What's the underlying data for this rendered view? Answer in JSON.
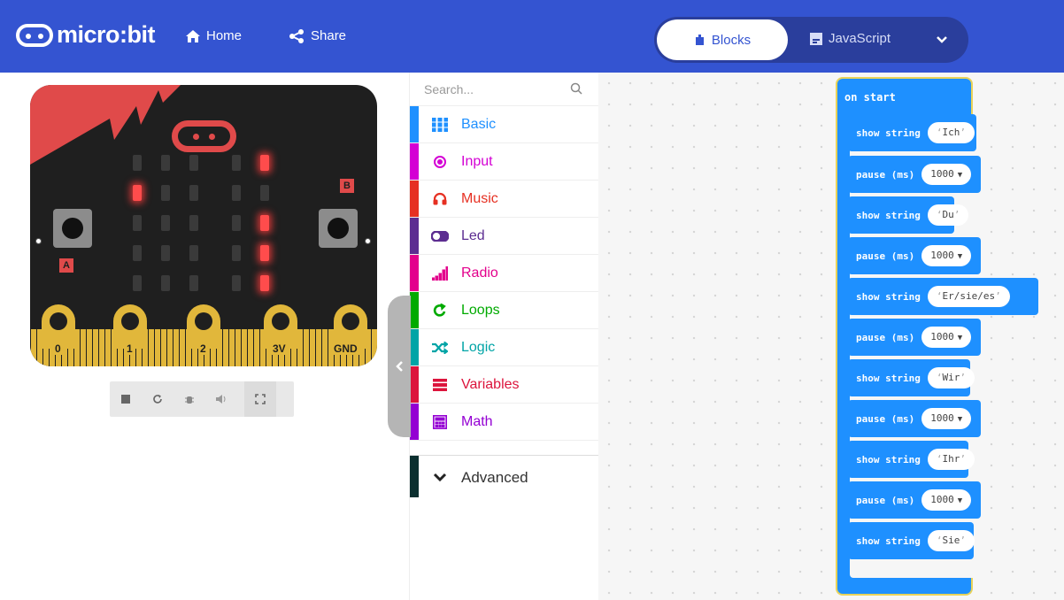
{
  "header": {
    "logo_text": "micro:bit",
    "home_label": "Home",
    "share_label": "Share",
    "blocks_label": "Blocks",
    "javascript_label": "JavaScript",
    "colors": {
      "bar": "#3454d1",
      "toggle_bg": "#2a3e9c"
    }
  },
  "simulator": {
    "button_a_label": "A",
    "button_b_label": "B",
    "pins": [
      "0",
      "1",
      "2",
      "3V",
      "GND"
    ],
    "led_matrix": [
      [
        0,
        0,
        0,
        0,
        1
      ],
      [
        1,
        0,
        0,
        0,
        0
      ],
      [
        0,
        0,
        0,
        0,
        1
      ],
      [
        0,
        0,
        0,
        0,
        1
      ],
      [
        0,
        0,
        0,
        0,
        1
      ]
    ],
    "controls": [
      "stop-icon",
      "restart-icon",
      "debug-icon",
      "mute-icon",
      "fullscreen-icon"
    ]
  },
  "toolbox": {
    "search_placeholder": "Search...",
    "categories": [
      {
        "label": "Basic",
        "color": "#1e90ff",
        "icon": "grid-icon"
      },
      {
        "label": "Input",
        "color": "#d400d4",
        "icon": "target-icon"
      },
      {
        "label": "Music",
        "color": "#e63022",
        "icon": "headphones-icon"
      },
      {
        "label": "Led",
        "color": "#5c2d91",
        "icon": "toggle-icon"
      },
      {
        "label": "Radio",
        "color": "#e3008c",
        "icon": "signal-bars-icon"
      },
      {
        "label": "Loops",
        "color": "#00aa00",
        "icon": "loop-arrow-icon"
      },
      {
        "label": "Logic",
        "color": "#00a4a6",
        "icon": "shuffle-icon"
      },
      {
        "label": "Variables",
        "color": "#dc143c",
        "icon": "lines-icon"
      },
      {
        "label": "Math",
        "color": "#9400d3",
        "icon": "calculator-icon"
      }
    ],
    "advanced_label": "Advanced",
    "advanced_color": "#0b2f2f"
  },
  "workspace": {
    "event_label": "on start",
    "blocks": [
      {
        "kind": "show string",
        "value": "Ich"
      },
      {
        "kind": "pause (ms)",
        "value": "1000"
      },
      {
        "kind": "show string",
        "value": "Du"
      },
      {
        "kind": "pause (ms)",
        "value": "1000"
      },
      {
        "kind": "show string",
        "value": "Er/sie/es"
      },
      {
        "kind": "pause (ms)",
        "value": "1000"
      },
      {
        "kind": "show string",
        "value": "Wir"
      },
      {
        "kind": "pause (ms)",
        "value": "1000"
      },
      {
        "kind": "show string",
        "value": "Ihr"
      },
      {
        "kind": "pause (ms)",
        "value": "1000"
      },
      {
        "kind": "show string",
        "value": "Sie"
      }
    ],
    "block_color": "#1e90ff"
  }
}
